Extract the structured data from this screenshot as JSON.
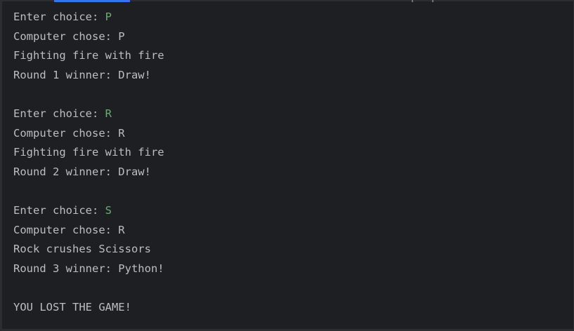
{
  "console": {
    "lines": [
      {
        "text": "Enter choice: ",
        "input": "P"
      },
      {
        "text": "Computer chose: P",
        "input": ""
      },
      {
        "text": "Fighting fire with fire",
        "input": ""
      },
      {
        "text": "Round 1 winner: Draw!",
        "input": ""
      },
      {
        "text": "",
        "input": ""
      },
      {
        "text": "Enter choice: ",
        "input": "R"
      },
      {
        "text": "Computer chose: R",
        "input": ""
      },
      {
        "text": "Fighting fire with fire",
        "input": ""
      },
      {
        "text": "Round 2 winner: Draw!",
        "input": ""
      },
      {
        "text": "",
        "input": ""
      },
      {
        "text": "Enter choice: ",
        "input": "S"
      },
      {
        "text": "Computer chose: R",
        "input": ""
      },
      {
        "text": "Rock crushes Scissors",
        "input": ""
      },
      {
        "text": "Round 3 winner: Python!",
        "input": ""
      },
      {
        "text": "",
        "input": ""
      },
      {
        "text": "YOU LOST THE GAME!",
        "input": ""
      }
    ]
  },
  "colors": {
    "background": "#1e1f22",
    "text": "#bcbec4",
    "user_input": "#6aab73",
    "active_tab_indicator": "#3574f0"
  }
}
